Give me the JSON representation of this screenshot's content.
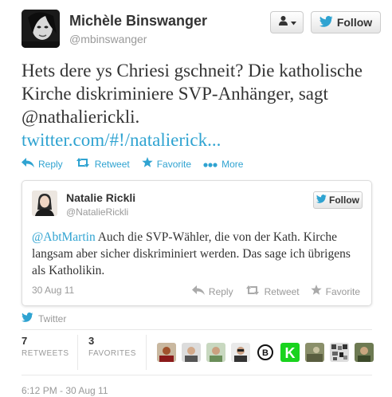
{
  "author": {
    "name": "Michèle Binswanger",
    "handle": "@mbinswanger"
  },
  "buttons": {
    "follow_label": "Follow"
  },
  "tweet": {
    "text": "Hets dere ys Chriesi gschneit? Die katholische Kirche diskriminiere SVP-Anhänger, sagt @nathalierickli.",
    "link": "twitter.com/#!/natalierick..."
  },
  "actions": {
    "reply": "Reply",
    "retweet": "Retweet",
    "favorite": "Favorite",
    "more": "More"
  },
  "embedded": {
    "name": "Natalie Rickli",
    "handle": "@NatalieRickli",
    "follow_label": "Follow",
    "mention": "@AbtMartin",
    "text": " Auch die SVP-Wähler, die von der Kath. Kirche langsam aber sicher diskriminiert werden. Das sage ich übrigens als Katholikin.",
    "date": "30 Aug 11",
    "actions": {
      "reply": "Reply",
      "retweet": "Retweet",
      "favorite": "Favorite"
    }
  },
  "via": "Twitter",
  "stats": {
    "retweets_count": "7",
    "retweets_label": "RETWEETS",
    "favorites_count": "3",
    "favorites_label": "FAVORITES"
  },
  "timestamp": "6:12 PM - 30 Aug 11",
  "colors": {
    "link": "#2fa3d1",
    "text": "#333333",
    "muted": "#999999"
  }
}
